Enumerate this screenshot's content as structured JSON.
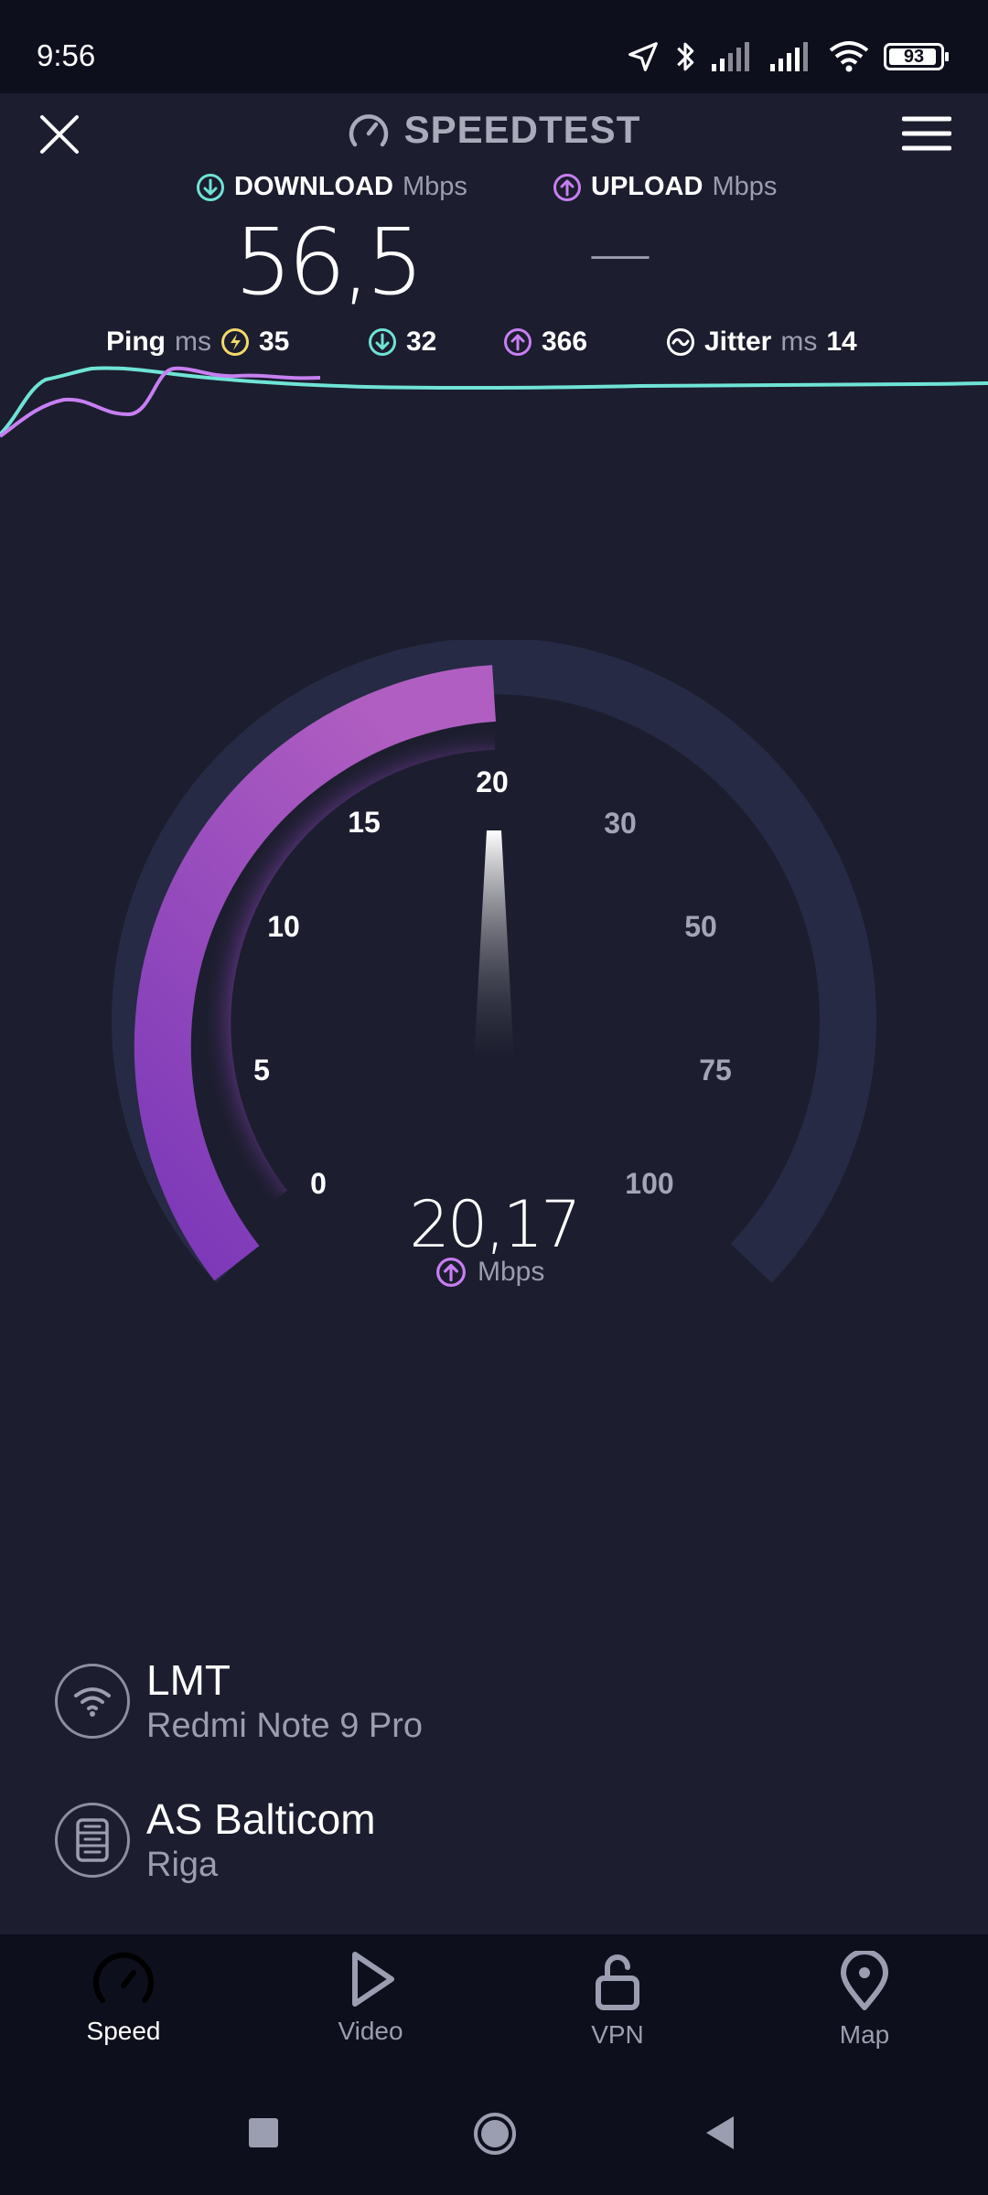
{
  "status_bar": {
    "time": "9:56",
    "battery": "93",
    "icons": [
      "location-arrow-icon",
      "bluetooth-icon",
      "signal-icon",
      "signal-icon",
      "wifi-icon",
      "battery-icon"
    ]
  },
  "header": {
    "title": "SPEEDTEST",
    "close_icon": "close-icon",
    "menu_icon": "menu-icon"
  },
  "download": {
    "label": "DOWNLOAD",
    "unit": "Mbps",
    "value": "56,5"
  },
  "upload": {
    "label": "UPLOAD",
    "unit": "Mbps",
    "value": "—"
  },
  "ping": {
    "label": "Ping",
    "unit": "ms",
    "idle": "35",
    "download": "32",
    "upload": "366"
  },
  "jitter": {
    "label": "Jitter",
    "unit": "ms",
    "value": "14"
  },
  "gauge": {
    "ticks": [
      "0",
      "5",
      "10",
      "15",
      "20",
      "30",
      "50",
      "75",
      "100"
    ],
    "value": "20,17",
    "unit": "Mbps",
    "current_tick": 20,
    "fill_fraction": 0.5
  },
  "provider": {
    "name": "LMT",
    "device": "Redmi Note 9 Pro"
  },
  "server": {
    "name": "AS Balticom",
    "location": "Riga"
  },
  "nav": {
    "items": [
      {
        "label": "Speed",
        "icon": "speedometer-icon",
        "active": true
      },
      {
        "label": "Video",
        "icon": "play-icon",
        "active": false
      },
      {
        "label": "VPN",
        "icon": "unlock-icon",
        "active": false
      },
      {
        "label": "Map",
        "icon": "map-pin-icon",
        "active": false
      }
    ]
  },
  "colors": {
    "background": "#1c1d2e",
    "download": "#6fe3d6",
    "upload": "#c77ff2",
    "ping_idle": "#f2d96b",
    "gauge_fill": "#a855c4",
    "gauge_track": "#262a44"
  }
}
